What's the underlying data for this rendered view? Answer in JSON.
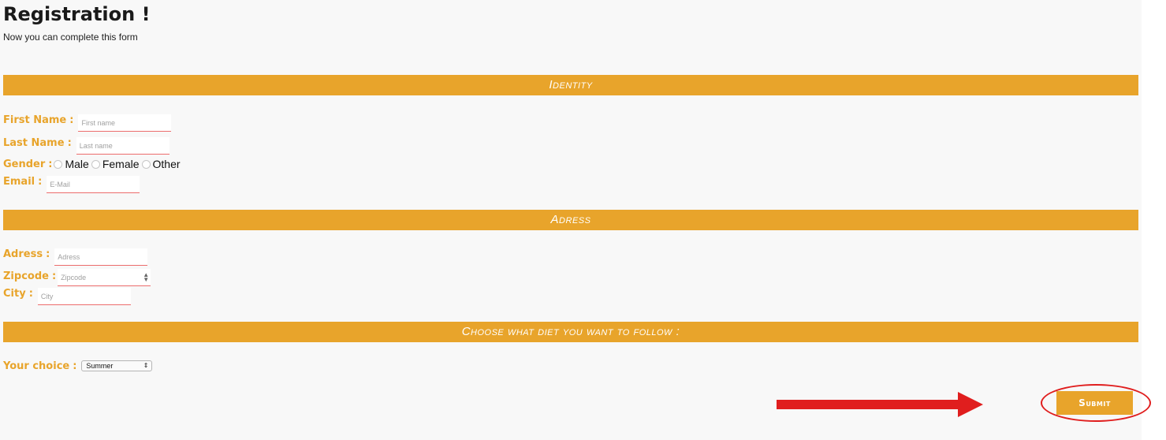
{
  "header": {
    "title": "Registration !",
    "subtitle": "Now you can complete this form"
  },
  "identity": {
    "section_title": "Identity",
    "first_name": {
      "label": "First Name",
      "colon": ":",
      "placeholder": "First name",
      "value": ""
    },
    "last_name": {
      "label": "Last Name",
      "colon": ":",
      "placeholder": "Last name",
      "value": ""
    },
    "gender": {
      "label": "Gender",
      "colon": ":",
      "options": [
        "Male",
        "Female",
        "Other"
      ],
      "selected": null
    },
    "email": {
      "label": "Email",
      "colon": ":",
      "placeholder": "E-Mail",
      "value": ""
    }
  },
  "address": {
    "section_title": "Adress",
    "adress": {
      "label": "Adress",
      "colon": ":",
      "placeholder": "Adress",
      "value": ""
    },
    "zipcode": {
      "label": "Zipcode",
      "colon": ":",
      "placeholder": "Zipcode",
      "value": ""
    },
    "city": {
      "label": "City",
      "colon": ":",
      "placeholder": "City",
      "value": ""
    }
  },
  "diet": {
    "section_title": "Choose what diet you want to follow :",
    "choice": {
      "label": "Your choice",
      "colon": ":",
      "selected": "Summer"
    }
  },
  "actions": {
    "submit_label": "Submit"
  },
  "colors": {
    "accent": "#e8a42b",
    "input_underline": "#ec6d6d",
    "annotation": "#e01e1e",
    "background": "#f8f8f8"
  }
}
